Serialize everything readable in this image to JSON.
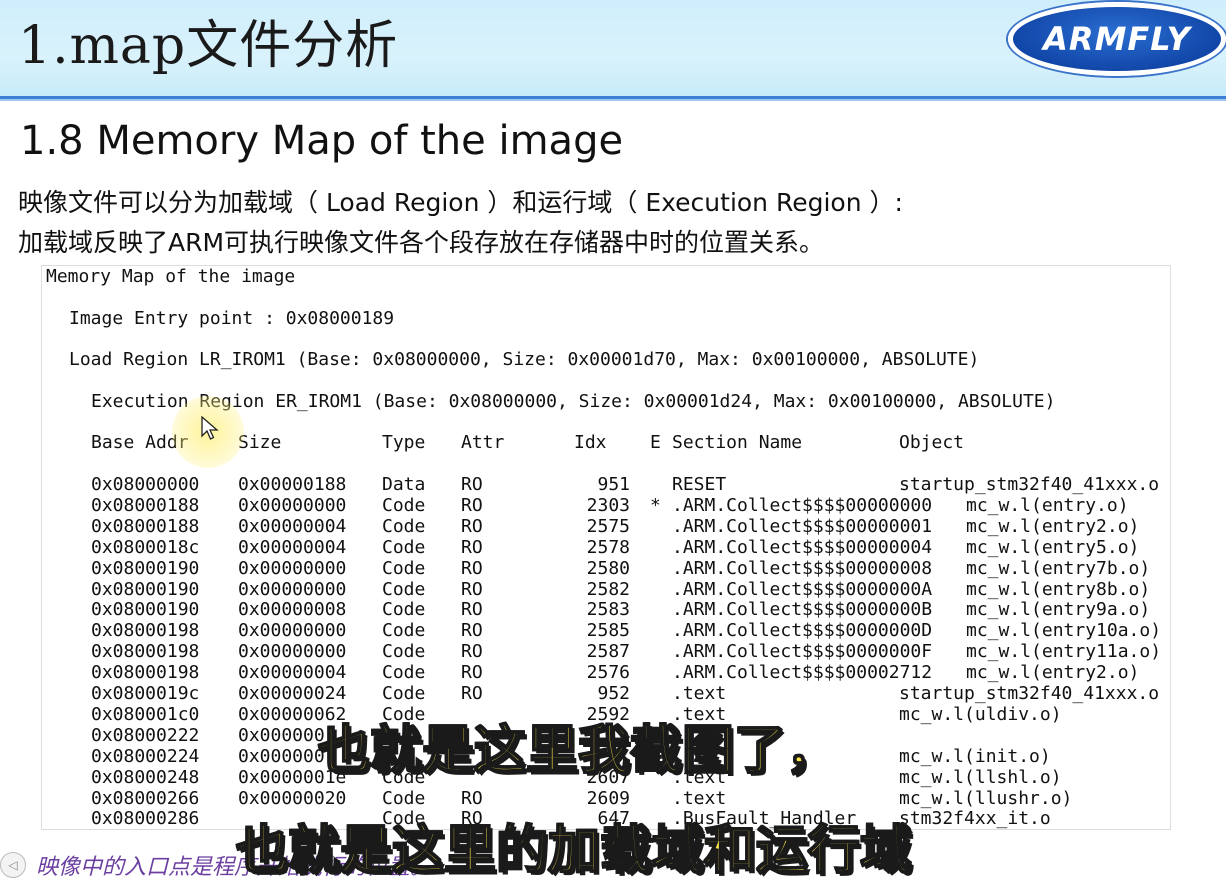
{
  "header": {
    "title": "1.map文件分析",
    "logo_text": "ARMFLY"
  },
  "slide": {
    "subtitle": "1.8 Memory Map of the image",
    "desc_line1": "映像文件可以分为加载域（  Load Region  ）和运行域（  Execution Region  ）:",
    "desc_line2": "加载域反映了ARM可执行映像文件各个段存放在存储器中时的位置关系。"
  },
  "screenshot": {
    "heading": "Memory Map of the image",
    "entry_point": "Image Entry point : 0x08000189",
    "load_region": "Load Region LR_IROM1 (Base: 0x08000000, Size: 0x00001d70, Max: 0x00100000, ABSOLUTE)",
    "exec_region": "Execution Region ER_IROM1 (Base: 0x08000000, Size: 0x00001d24, Max: 0x00100000, ABSOLUTE)",
    "columns": {
      "base": "Base Addr",
      "size": "Size",
      "type": "Type",
      "attr": "Attr",
      "idx": "Idx",
      "e": "E",
      "section": "Section Name",
      "object": "Object"
    },
    "rows": [
      {
        "base": "0x08000000",
        "size": "0x00000188",
        "type": "Data",
        "attr": "RO",
        "idx": "951",
        "e": "",
        "section": "RESET",
        "object": "startup_stm32f40_41xxx.o",
        "wide": true
      },
      {
        "base": "0x08000188",
        "size": "0x00000000",
        "type": "Code",
        "attr": "RO",
        "idx": "2303",
        "e": "*",
        "section": ".ARM.Collect$$$$00000000",
        "object": "mc_w.l(entry.o)",
        "wide": false
      },
      {
        "base": "0x08000188",
        "size": "0x00000004",
        "type": "Code",
        "attr": "RO",
        "idx": "2575",
        "e": "",
        "section": ".ARM.Collect$$$$00000001",
        "object": "mc_w.l(entry2.o)",
        "wide": false
      },
      {
        "base": "0x0800018c",
        "size": "0x00000004",
        "type": "Code",
        "attr": "RO",
        "idx": "2578",
        "e": "",
        "section": ".ARM.Collect$$$$00000004",
        "object": "mc_w.l(entry5.o)",
        "wide": false
      },
      {
        "base": "0x08000190",
        "size": "0x00000000",
        "type": "Code",
        "attr": "RO",
        "idx": "2580",
        "e": "",
        "section": ".ARM.Collect$$$$00000008",
        "object": "mc_w.l(entry7b.o)",
        "wide": false
      },
      {
        "base": "0x08000190",
        "size": "0x00000000",
        "type": "Code",
        "attr": "RO",
        "idx": "2582",
        "e": "",
        "section": ".ARM.Collect$$$$0000000A",
        "object": "mc_w.l(entry8b.o)",
        "wide": false
      },
      {
        "base": "0x08000190",
        "size": "0x00000008",
        "type": "Code",
        "attr": "RO",
        "idx": "2583",
        "e": "",
        "section": ".ARM.Collect$$$$0000000B",
        "object": "mc_w.l(entry9a.o)",
        "wide": false
      },
      {
        "base": "0x08000198",
        "size": "0x00000000",
        "type": "Code",
        "attr": "RO",
        "idx": "2585",
        "e": "",
        "section": ".ARM.Collect$$$$0000000D",
        "object": "mc_w.l(entry10a.o)",
        "wide": false
      },
      {
        "base": "0x08000198",
        "size": "0x00000000",
        "type": "Code",
        "attr": "RO",
        "idx": "2587",
        "e": "",
        "section": ".ARM.Collect$$$$0000000F",
        "object": "mc_w.l(entry11a.o)",
        "wide": false
      },
      {
        "base": "0x08000198",
        "size": "0x00000004",
        "type": "Code",
        "attr": "RO",
        "idx": "2576",
        "e": "",
        "section": ".ARM.Collect$$$$00002712",
        "object": "mc_w.l(entry2.o)",
        "wide": false
      },
      {
        "base": "0x0800019c",
        "size": "0x00000024",
        "type": "Code",
        "attr": "RO",
        "idx": "952",
        "e": "",
        "section": ".text",
        "object": "startup_stm32f40_41xxx.o",
        "wide": true
      },
      {
        "base": "0x080001c0",
        "size": "0x00000062",
        "type": "Code",
        "attr": "",
        "idx": "2592",
        "e": "",
        "section": ".text",
        "object": "mc_w.l(uldiv.o)",
        "wide": true
      },
      {
        "base": "0x08000222",
        "size": "0x000000",
        "type": "",
        "attr": "",
        "idx": "",
        "e": "",
        "section": "",
        "object": "",
        "wide": true
      },
      {
        "base": "0x08000224",
        "size": "0x000000",
        "type": "",
        "attr": "",
        "idx": "",
        "e": "",
        "section": "",
        "object": "mc_w.l(init.o)",
        "wide": true
      },
      {
        "base": "0x08000248",
        "size": "0x0000001e",
        "type": "Code",
        "attr": "",
        "idx": "2607",
        "e": "",
        "section": ".text",
        "object": "mc_w.l(llshl.o)",
        "wide": true
      },
      {
        "base": "0x08000266",
        "size": "0x00000020",
        "type": "Code",
        "attr": "RO",
        "idx": "2609",
        "e": "",
        "section": ".text",
        "object": "mc_w.l(llushr.o)",
        "wide": true
      },
      {
        "base": "0x08000286",
        "size": "",
        "type": "Code",
        "attr": "RO",
        "idx": "647",
        "e": "",
        "section": ".BusFault_Handler",
        "object": "stm32f4xx_it.o",
        "wide": true
      }
    ]
  },
  "footer": {
    "note": "映像中的入口点是程序开始执行的位置。"
  },
  "captions": {
    "line1": "也就是这里我截图了，",
    "line2": "也就是这里的加载域和运行域"
  },
  "colors": {
    "header_bg": "#cfeefb",
    "header_rule": "#3d7fd6",
    "logo_blue": "#1147a8",
    "caption_yellow": "#ffe94a",
    "footer_purple": "#6b3fa0"
  }
}
